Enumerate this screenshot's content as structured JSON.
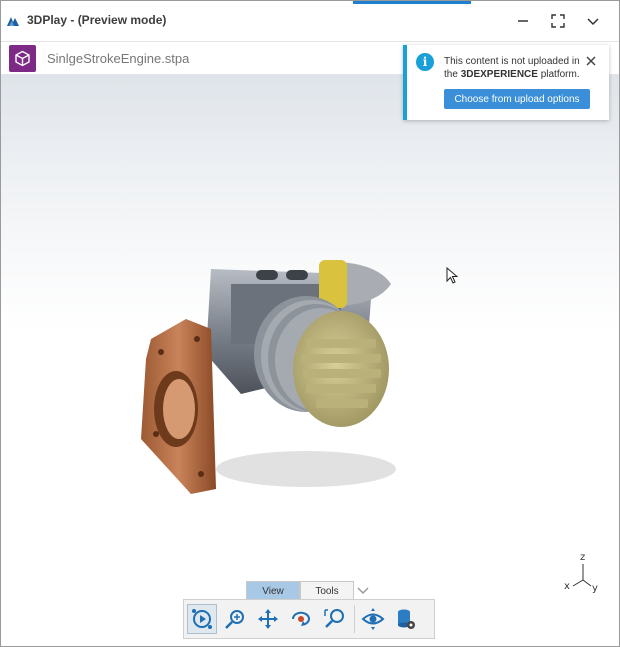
{
  "window": {
    "title": "3DPlay - (Preview mode)",
    "logo_icon": "3ds-logo-icon",
    "controls": [
      "minimize-icon",
      "maximize-icon",
      "chevron-down-icon"
    ]
  },
  "file": {
    "name": "SinlgeStrokeEngine.stpa",
    "icon": "3d-part-icon",
    "icon_color": "#7d2a87"
  },
  "notification": {
    "icon": "info-icon",
    "message_prefix": "This content is not uploaded in the ",
    "message_brand": "3DEXPERIENCE",
    "message_suffix": " platform.",
    "button_label": "Choose from upload options",
    "accent_color": "#1aa0d8",
    "button_color": "#3a8fd8"
  },
  "toolbar": {
    "tabs": [
      {
        "label": "View",
        "active": true
      },
      {
        "label": "Tools",
        "active": false
      }
    ],
    "tools": [
      {
        "name": "play-animation-icon",
        "selected": true
      },
      {
        "name": "zoom-icon",
        "selected": false
      },
      {
        "name": "pan-icon",
        "selected": false
      },
      {
        "name": "rotate-icon",
        "selected": false
      },
      {
        "name": "zoom-fit-icon",
        "selected": false
      },
      {
        "name": "view-eye-icon",
        "selected": false
      },
      {
        "name": "data-settings-icon",
        "selected": false
      }
    ]
  },
  "axes": {
    "z": "z",
    "x": "x",
    "y": "y"
  }
}
